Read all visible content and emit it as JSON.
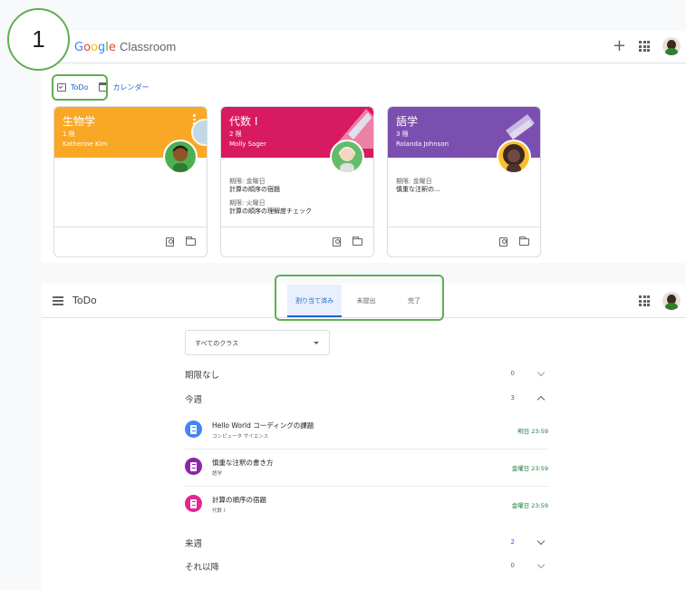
{
  "app": {
    "logo_g": "G",
    "logo_o1": "o",
    "logo_o2": "o",
    "logo_g2": "g",
    "logo_l": "l",
    "logo_e": "e",
    "logo_classroom": "Classroom",
    "plus_label": "+"
  },
  "subnav": {
    "todo_label": "ToDo",
    "calendar_label": "カレンダー"
  },
  "cards": [
    {
      "title": "生物学",
      "period": "1 限",
      "teacher": "Katherine Kim",
      "color": "#f9a825",
      "due": []
    },
    {
      "title": "代数 I",
      "period": "2 限",
      "teacher": "Molly Sager",
      "color": "#d81b60",
      "due": [
        {
          "label": "期限: 金曜日",
          "title": "計算の順序の宿題"
        },
        {
          "label": "期限: 火曜日",
          "title": "計算の順序の理解度チェック"
        }
      ]
    },
    {
      "title": "語学",
      "period": "3 限",
      "teacher": "Rolanda Johnson",
      "color": "#7b4fb0",
      "due": [
        {
          "label": "期限: 金曜日",
          "title": "慎重な注釈の..."
        }
      ]
    }
  ],
  "todo": {
    "title": "ToDo",
    "tabs": [
      {
        "label": "割り当て済み",
        "active": true
      },
      {
        "label": "未提出",
        "active": false
      },
      {
        "label": "完了",
        "active": false
      }
    ],
    "filter": {
      "selected": "すべてのクラス"
    },
    "sections": [
      {
        "label": "期限なし",
        "count": "0"
      },
      {
        "label": "今週",
        "count": "3"
      },
      {
        "label": "来週",
        "count": "2"
      },
      {
        "label": "それ以降",
        "count": "0"
      }
    ],
    "assignments": [
      {
        "title": "Hello World コーディングの課題",
        "class": "コンピュータ サイエンス",
        "due": "明日 23:59",
        "color": "#4285f4"
      },
      {
        "title": "慎重な注釈の書き方",
        "class": "語学",
        "due": "金曜日 23:59",
        "color": "#8e24aa"
      },
      {
        "title": "計算の順序の宿題",
        "class": "代数 I",
        "due": "金曜日 23:59",
        "color": "#e52592"
      }
    ]
  },
  "annotation": {
    "step_number": "1",
    "highlight_color": "#5fae52"
  },
  "colors": {
    "accent_blue": "#1967d2",
    "due_green": "#188038"
  }
}
